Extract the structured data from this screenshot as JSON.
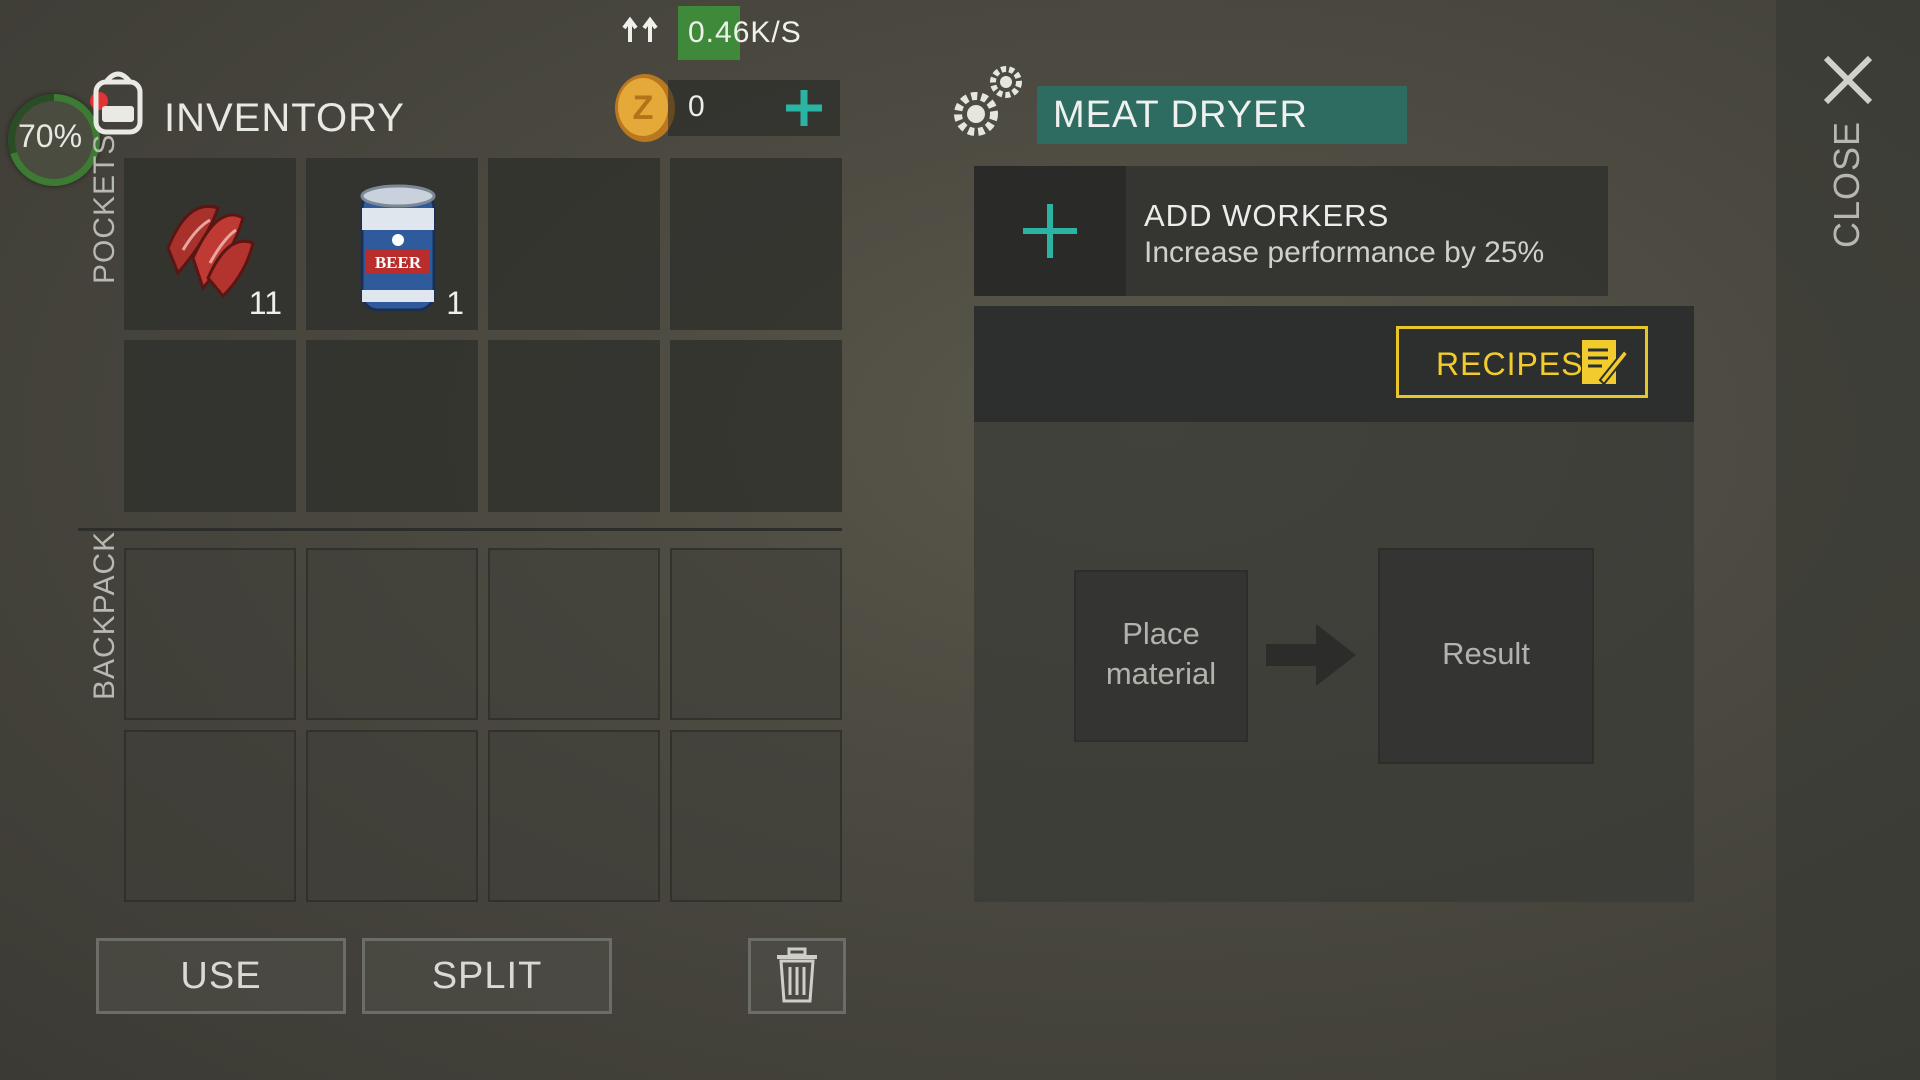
{
  "network": {
    "rate": "0.46K/S",
    "icon": "sync-arrows-icon"
  },
  "status": {
    "percent": "70%",
    "fill": 0.7,
    "alert_color": "#e23434"
  },
  "inventory": {
    "title": "INVENTORY",
    "coins": "0",
    "pockets_label": "POCKETS",
    "backpack_label": "BACKPACK",
    "pockets": [
      {
        "item": "raw-meat",
        "count": "11"
      },
      {
        "item": "beer-can",
        "count": "1"
      },
      {
        "item": "",
        "count": ""
      },
      {
        "item": "",
        "count": ""
      },
      {
        "item": "",
        "count": ""
      },
      {
        "item": "",
        "count": ""
      },
      {
        "item": "",
        "count": ""
      },
      {
        "item": "",
        "count": ""
      }
    ]
  },
  "actions": {
    "use": "USE",
    "split": "SPLIT",
    "trash_icon": "trash-icon"
  },
  "station": {
    "title": "MEAT DRYER",
    "title_color": "#2e6b61",
    "workers_title": "ADD WORKERS",
    "workers_desc": "Increase performance by 25%",
    "recipes": "RECIPES",
    "recipes_color": "#e7c62a",
    "place_material_line1": "Place",
    "place_material_line2": "material",
    "result": "Result"
  },
  "close": {
    "label": "CLOSE"
  },
  "colors": {
    "accent_teal": "#2bb3a3",
    "net_green": "#3e8a3a"
  }
}
